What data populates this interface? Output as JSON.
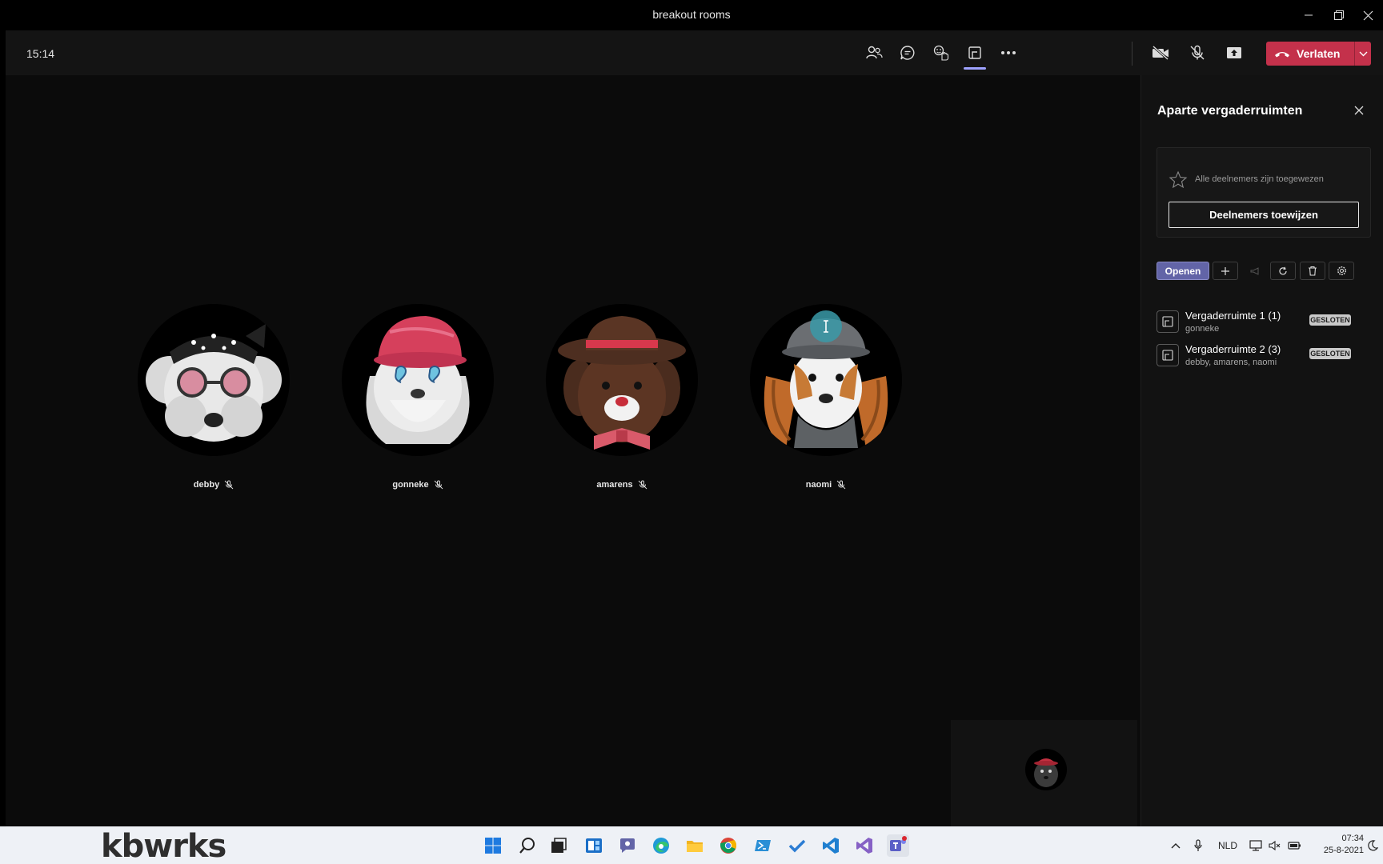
{
  "window": {
    "title": "breakout rooms"
  },
  "meeting": {
    "time": "15:14",
    "leave_label": "Verlaten"
  },
  "participants": [
    {
      "name": "debby",
      "muted": true
    },
    {
      "name": "gonneke",
      "muted": true
    },
    {
      "name": "amarens",
      "muted": true
    },
    {
      "name": "naomi",
      "muted": true
    }
  ],
  "panel": {
    "title": "Aparte vergaderruimten",
    "assign_status": "Alle deelnemers zijn toegewezen",
    "assign_button": "Deelnemers toewijzen",
    "open_button": "Openen",
    "rooms": [
      {
        "name": "Vergaderruimte 1 (1)",
        "members": "gonneke",
        "status": "GESLOTEN"
      },
      {
        "name": "Vergaderruimte 2 (3)",
        "members": "debby, amarens, naomi",
        "status": "GESLOTEN"
      }
    ]
  },
  "taskbar": {
    "logo": "kbwrks",
    "language": "NLD",
    "time": "07:34",
    "date": "25-8-2021"
  },
  "colors": {
    "accent": "#6264a7",
    "leave": "#c4314b",
    "toolbar": "#141414",
    "panel": "#121212"
  }
}
